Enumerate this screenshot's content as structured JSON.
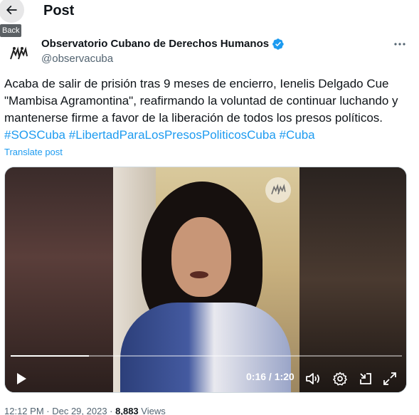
{
  "header": {
    "title": "Post",
    "back_tooltip": "Back"
  },
  "author": {
    "name": "Observatorio Cubano de Derechos Humanos",
    "handle": "@observacuba",
    "verified": true,
    "verified_color": "#1d9bf0"
  },
  "post": {
    "text": "Acaba de salir de prisión tras 9 meses de encierro, Ienelis Delgado Cue \"Mambisa Agramontina\", reafirmando la voluntad de continuar luchando y mantenerse firme a favor de la liberación de todos los presos políticos.",
    "hashtags": [
      "#SOSCuba",
      "#LibertadParaLosPresosPoliticosCuba",
      "#Cuba"
    ],
    "translate_label": "Translate post"
  },
  "video": {
    "time_display": "0:16 / 1:20",
    "progress_fraction": 0.2,
    "icons": {
      "play": "play-icon",
      "volume": "volume-icon",
      "settings": "gear-icon",
      "minimize": "minimize-icon",
      "fullscreen": "fullscreen-icon"
    }
  },
  "meta": {
    "time": "12:12 PM",
    "separator": " · ",
    "date": "Dec 29, 2023",
    "views_count": "8,883",
    "views_label": " Views"
  },
  "colors": {
    "accent": "#1d9bf0",
    "text_primary": "#0f1419",
    "text_secondary": "#536471"
  }
}
